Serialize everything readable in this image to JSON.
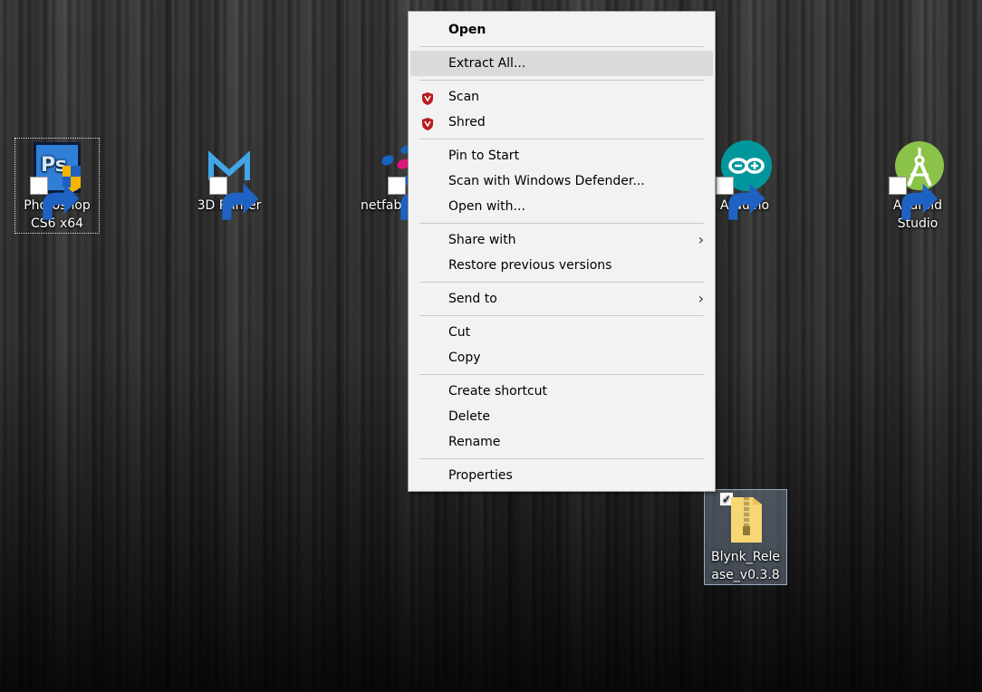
{
  "desktop": {
    "icons": [
      {
        "label": "Photoshop CS6 x64",
        "icon": "photoshop-icon"
      },
      {
        "label": "3D Printer",
        "icon": "3d-printer-icon"
      },
      {
        "label": "netfabb",
        "icon": "netfabb-icon"
      },
      {
        "label": "Arduino",
        "icon": "arduino-icon"
      },
      {
        "label": "Android Studio",
        "icon": "android-studio-icon"
      },
      {
        "label": "Blynk_Release_v0.3.8",
        "icon": "zip-folder-icon"
      }
    ]
  },
  "context_menu": {
    "items": [
      {
        "label": "Open"
      },
      {
        "label": "Extract All..."
      },
      {
        "label": "Scan",
        "icon": "mcafee-shield-icon"
      },
      {
        "label": "Shred",
        "icon": "mcafee-shield-icon"
      },
      {
        "label": "Pin to Start"
      },
      {
        "label": "Scan with Windows Defender..."
      },
      {
        "label": "Open with..."
      },
      {
        "label": "Share with",
        "submenu": true
      },
      {
        "label": "Restore previous versions"
      },
      {
        "label": "Send to",
        "submenu": true
      },
      {
        "label": "Cut"
      },
      {
        "label": "Copy"
      },
      {
        "label": "Create shortcut"
      },
      {
        "label": "Delete"
      },
      {
        "label": "Rename"
      },
      {
        "label": "Properties"
      }
    ],
    "submenu_arrow": "›"
  },
  "colors": {
    "menu_bg": "#f2f2f2",
    "menu_hover": "#dadada",
    "arduino": "#00979c",
    "android": "#8bc34a"
  }
}
